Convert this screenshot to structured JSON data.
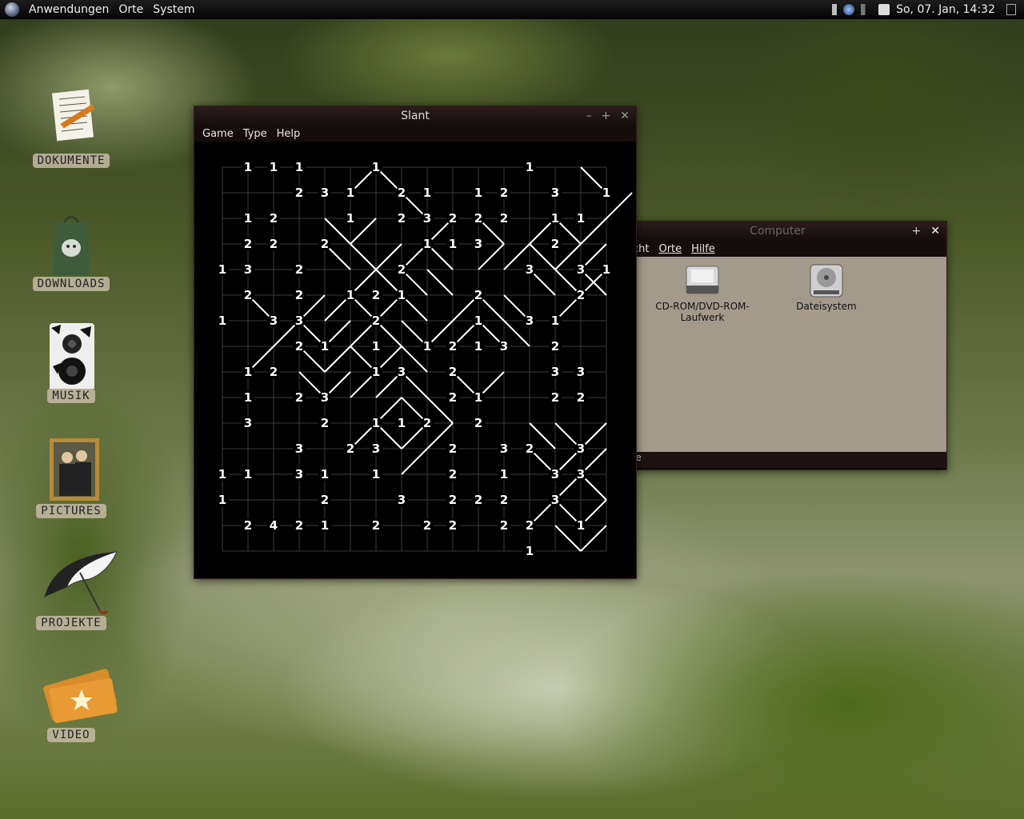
{
  "panel": {
    "menu": [
      "Anwendungen",
      "Orte",
      "System"
    ],
    "clock": "So, 07. Jan, 14:32"
  },
  "desktop": {
    "icons": [
      {
        "label": "DOKUMENTE",
        "icon": "document-icon"
      },
      {
        "label": "DOWNLOADS",
        "icon": "downloads-bag-icon"
      },
      {
        "label": "MUSIK",
        "icon": "speaker-icon"
      },
      {
        "label": "PICTURES",
        "icon": "picture-frame-icon"
      },
      {
        "label": "PROJEKTE",
        "icon": "umbrella-icon"
      },
      {
        "label": "VIDEO",
        "icon": "cinema-tickets-icon"
      }
    ]
  },
  "slant": {
    "title": "Slant",
    "menu": [
      "Game",
      "Type",
      "Help"
    ],
    "clues": [
      [
        "",
        "1",
        "1",
        "1",
        "",
        "",
        "1",
        "",
        "",
        "",
        "",
        "",
        "1",
        "",
        "",
        ""
      ],
      [
        "",
        "",
        "",
        "2",
        "3",
        "1",
        "",
        "2",
        "1",
        "",
        "1",
        "2",
        "",
        "3",
        "",
        "1"
      ],
      [
        "",
        "1",
        "2",
        "",
        "",
        "1",
        "",
        "2",
        "3",
        "2",
        "2",
        "2",
        "",
        "1",
        "1",
        ""
      ],
      [
        "",
        "2",
        "2",
        "",
        "2",
        "",
        "",
        "",
        "1",
        "1",
        "3",
        "",
        "",
        "2",
        "",
        ""
      ],
      [
        "1",
        "3",
        "",
        "2",
        "",
        "",
        "",
        "2",
        "",
        "",
        "",
        "",
        "3",
        "",
        "3",
        "1"
      ],
      [
        "",
        "2",
        "",
        "2",
        "",
        "1",
        "2",
        "1",
        "",
        "",
        "2",
        "",
        "",
        "",
        "2",
        ""
      ],
      [
        "1",
        "",
        "3",
        "3",
        "",
        "",
        "2",
        "",
        "",
        "",
        "1",
        "",
        "3",
        "1",
        "",
        ""
      ],
      [
        "",
        "",
        "",
        "2",
        "1",
        "",
        "1",
        "",
        "1",
        "2",
        "1",
        "3",
        "",
        "2",
        "",
        ""
      ],
      [
        "",
        "1",
        "2",
        "",
        "",
        "",
        "1",
        "3",
        "",
        "2",
        "",
        "",
        "",
        "3",
        "3",
        ""
      ],
      [
        "",
        "1",
        "",
        "2",
        "3",
        "",
        "",
        "",
        "",
        "2",
        "1",
        "",
        "",
        "2",
        "2",
        ""
      ],
      [
        "",
        "3",
        "",
        "",
        "2",
        "",
        "1",
        "1",
        "2",
        "",
        "2",
        "",
        "",
        "",
        "",
        ""
      ],
      [
        "",
        "",
        "",
        "3",
        "",
        "2",
        "3",
        "",
        "",
        "2",
        "",
        "3",
        "2",
        "",
        "3",
        ""
      ],
      [
        "1",
        "1",
        "",
        "3",
        "1",
        "",
        "1",
        "",
        "",
        "2",
        "",
        "1",
        "",
        "3",
        "3",
        ""
      ],
      [
        "1",
        "",
        "",
        "",
        "2",
        "",
        "",
        "3",
        "",
        "2",
        "2",
        "2",
        "",
        "3",
        "",
        ""
      ],
      [
        "",
        "2",
        "4",
        "2",
        "1",
        "",
        "2",
        "",
        "2",
        "2",
        "",
        "2",
        "2",
        "",
        "1",
        ""
      ],
      [
        "",
        "",
        "",
        "",
        "",
        "",
        "",
        "",
        "",
        "",
        "",
        "",
        "1",
        "",
        "",
        ""
      ]
    ],
    "slashes": [
      "...............\\",
      "....../........\\",
      ".......\\...../..",
      "....\\.....\\..\\/.",
      "....\\/.......\\..",
      "....\\......\\.../",
      "..../........\\/.",
      "......./.........",
      "...................",
      "......................",
      "..............",
      "..............",
      "..............",
      "..............",
      ".............."
    ]
  },
  "filemanager": {
    "title": "Computer",
    "menu": [
      "cht",
      "Orte",
      "Hilfe"
    ],
    "items": [
      {
        "label": "CD-ROM/DVD-ROM-Laufwerk",
        "icon": "optical-drive-icon"
      },
      {
        "label": "Dateisystem",
        "icon": "hard-disk-icon"
      }
    ],
    "status": "le"
  },
  "colors": {
    "panel": "#0a0a0a",
    "board_bg": "#000000",
    "grid": "#404040",
    "fm_bg": "#a39a8c"
  }
}
